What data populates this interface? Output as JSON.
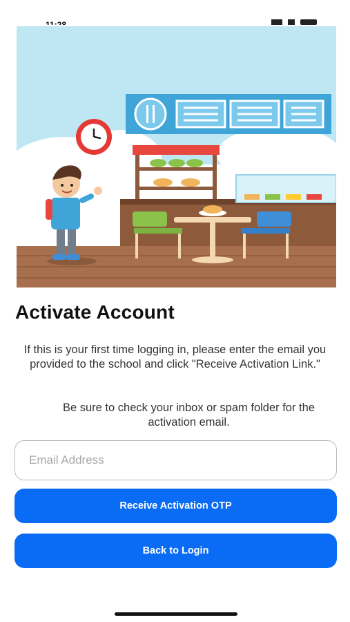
{
  "status_bar": {
    "time": "11:28"
  },
  "hero": {
    "image": "school-cafeteria-illustration",
    "colors": {
      "sky": "#bfe6f3",
      "floor": "#a86f4e",
      "counter": "#8d5a3b",
      "sign": "#3fa5d8"
    }
  },
  "page": {
    "title": "Activate Account",
    "instructions": "If this is your first time logging in, please enter the email you provided to the school and click \"Receive Activation Link.\"",
    "reminder": "Be sure to check your inbox or spam folder for the activation email."
  },
  "form": {
    "email_placeholder": "Email Address",
    "email_value": ""
  },
  "buttons": {
    "receive_otp": "Receive Activation OTP",
    "back_to_login": "Back to Login"
  },
  "theme": {
    "primary": "#0a6cf5"
  }
}
